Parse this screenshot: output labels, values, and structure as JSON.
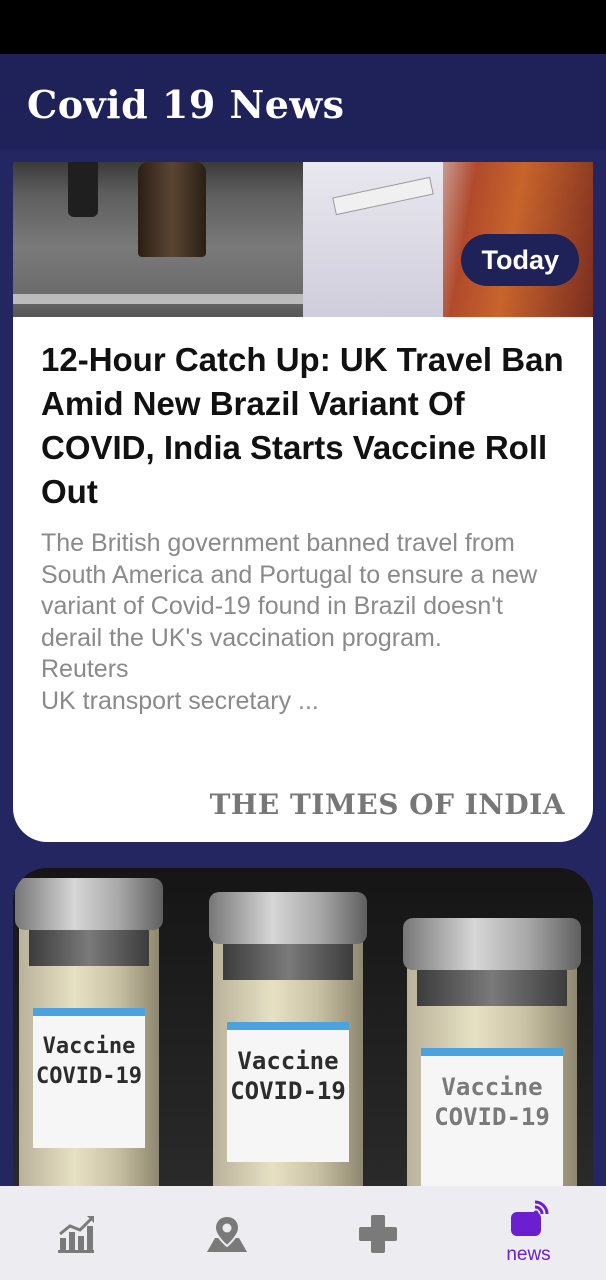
{
  "header": {
    "title": "Covid 19 News"
  },
  "articles": [
    {
      "badge": "Today",
      "title": "12-Hour Catch Up: UK Travel Ban Amid New Brazil Variant Of COVID, India Starts Vaccine Roll Out",
      "body": "The British government banned travel from South America and Portugal to ensure a new variant of Covid-19 found in Brazil doesn't derail the UK's vaccination program.\nReuters\nUK transport secretary ...",
      "source": "THE TIMES OF INDIA",
      "image": "airport-and-vaccination-photo"
    },
    {
      "image": "vaccine-vials-photo",
      "vial_labels": [
        "Vaccine\nCOVID-19",
        "Vaccine\nCOVID-19",
        "Vaccine\nCOVID-19"
      ]
    }
  ],
  "bottom_nav": {
    "items": [
      {
        "icon": "stats-chart-icon",
        "label": ""
      },
      {
        "icon": "map-pin-icon",
        "label": ""
      },
      {
        "icon": "medical-cross-icon",
        "label": ""
      },
      {
        "icon": "news-broadcast-icon",
        "label": "news",
        "active": true
      }
    ]
  },
  "colors": {
    "primary": "#1e2259",
    "active": "#6a1fd1",
    "inactive": "#7a7a7a"
  }
}
